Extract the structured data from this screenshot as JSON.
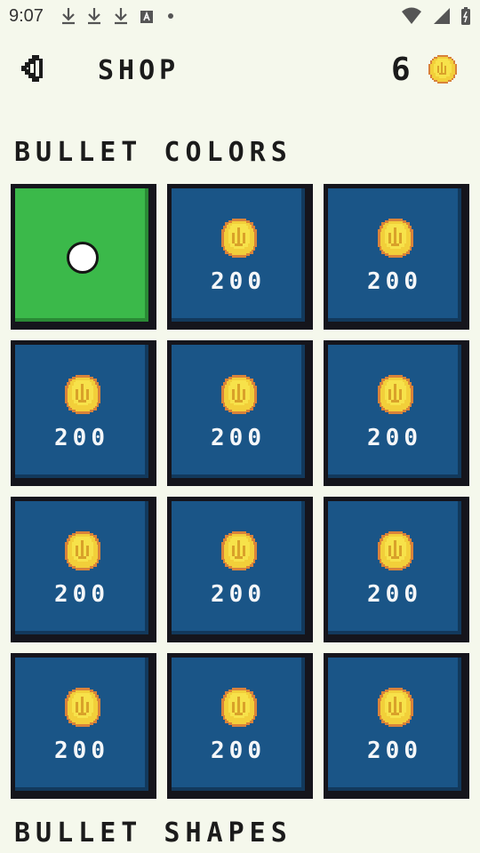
{
  "status_bar": {
    "time": "9:07"
  },
  "header": {
    "title": "SHOP",
    "coins": "6"
  },
  "sections": {
    "bullet_colors": "BULLET COLORS",
    "bullet_shapes": "BULLET SHAPES"
  },
  "tiles": [
    {
      "price": "",
      "selected": true
    },
    {
      "price": "200"
    },
    {
      "price": "200"
    },
    {
      "price": "200"
    },
    {
      "price": "200"
    },
    {
      "price": "200"
    },
    {
      "price": "200"
    },
    {
      "price": "200"
    },
    {
      "price": "200"
    },
    {
      "price": "200"
    },
    {
      "price": "200"
    },
    {
      "price": "200"
    }
  ],
  "colors": {
    "background": "#f5f8ec",
    "tile_blue": "#1a5587",
    "tile_selected_green": "#3bb94a",
    "coin_gold": "#f2cf3a"
  }
}
